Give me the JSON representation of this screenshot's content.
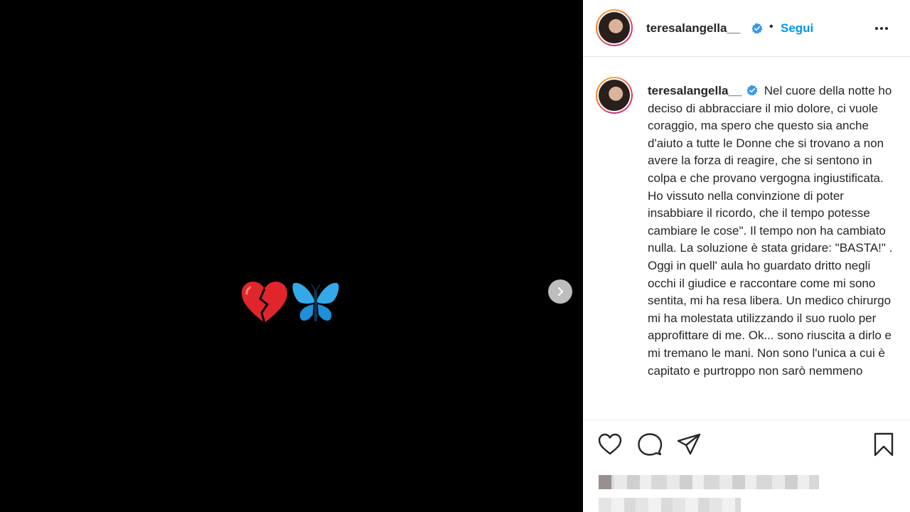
{
  "post": {
    "media_emoji_icons": [
      "broken-heart-icon",
      "butterfly-icon"
    ],
    "next_icon": "chevron-right-icon"
  },
  "header": {
    "username": "teresalangella__",
    "separator": "•",
    "follow_label": "Segui",
    "more_icon": "more-horizontal-icon"
  },
  "caption": {
    "username": "teresalangella__",
    "text": "Nel cuore della notte ho deciso di abbracciare il mio dolore, ci vuole coraggio, ma spero che questo sia anche d'aiuto a tutte le Donne che si trovano a non avere la forza di reagire, che si sentono in colpa e che provano vergogna ingiustificata. Ho vissuto nella convinzione di poter insabbiare il ricordo, che il tempo potesse cambiare le cose\". Il tempo non ha cambiato nulla. La soluzione è stata gridare: \"BASTA!\" . Oggi in quell' aula ho guardato dritto negli occhi il giudice e raccontare come mi sono sentita, mi ha resa libera. Un medico chirurgo mi ha molestata utilizzando il suo ruolo per approfittare di me. Ok... sono riuscita a dirlo e mi tremano le mani. Non sono l'unica a cui è capitato e purtroppo non sarò nemmeno"
  },
  "actions": {
    "icons": [
      "heart-icon",
      "comment-icon",
      "share-icon",
      "bookmark-icon"
    ]
  },
  "colors": {
    "accent": "#0095f6",
    "verified": "#3897f0",
    "text": "#262626"
  }
}
